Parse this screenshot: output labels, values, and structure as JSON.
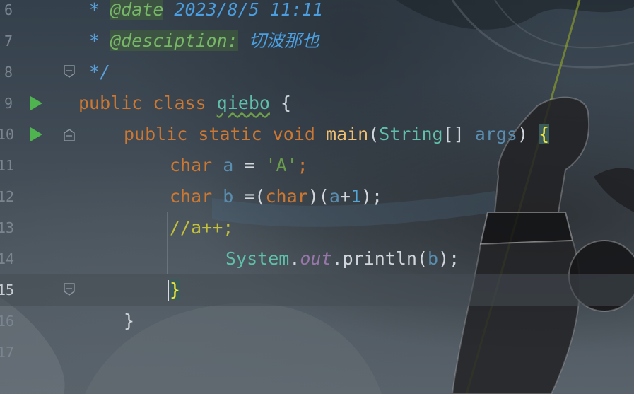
{
  "editor": {
    "line_numbers": [
      "6",
      "7",
      "8",
      "9",
      "10",
      "11",
      "12",
      "13",
      "14",
      "15",
      "16",
      "17"
    ],
    "current_line": "15",
    "gutter_icons": {
      "run_class": "run-icon",
      "run_main": "run-icon",
      "fold": "fold-icon"
    },
    "code": {
      "l6_star": "* ",
      "l6_tag": "@date",
      "l6_val": " 2023/8/5 11:11",
      "l7_star": "* ",
      "l7_tag": "@desciption:",
      "l7_val": " 切波那也",
      "l8_end": "*/",
      "l9_kw": "public class ",
      "l9_class": "qiebo",
      "l9_brace": " {",
      "l10_kw": "public static void ",
      "l10_fn": "main",
      "l10_paren_open": "(",
      "l10_type": "String",
      "l10_arr": "[] ",
      "l10_param": "args",
      "l10_paren_close": ") ",
      "l10_brace": "{",
      "l11_kw": "char ",
      "l11_var": "a",
      "l11_eq": " = ",
      "l11_str": "'A'",
      "l11_semi": ";",
      "l12_kw": "char ",
      "l12_var": "b",
      "l12_eq": " =(",
      "l12_cast": "char",
      "l12_mid": ")(",
      "l12_var2": "a",
      "l12_plus": "+",
      "l12_num": "1",
      "l12_end": ");",
      "l13_comment": "//a++;",
      "l14_sys": "System",
      "l14_dot1": ".",
      "l14_out": "out",
      "l14_call": ".println(",
      "l14_arg": "b",
      "l14_end": ");",
      "l15_brace": "}",
      "l16_brace": "}"
    }
  },
  "colors": {
    "keyword": "#cc7832",
    "doc_tag": "#77b767",
    "doc_value": "#4b9fe0",
    "class_name": "#5fbfa8",
    "function": "#f0c070",
    "string": "#6a9b4c",
    "number": "#53a6d6",
    "comment": "#c4c03a",
    "field": "#9876aa",
    "run_icon": "#4fb34f"
  }
}
